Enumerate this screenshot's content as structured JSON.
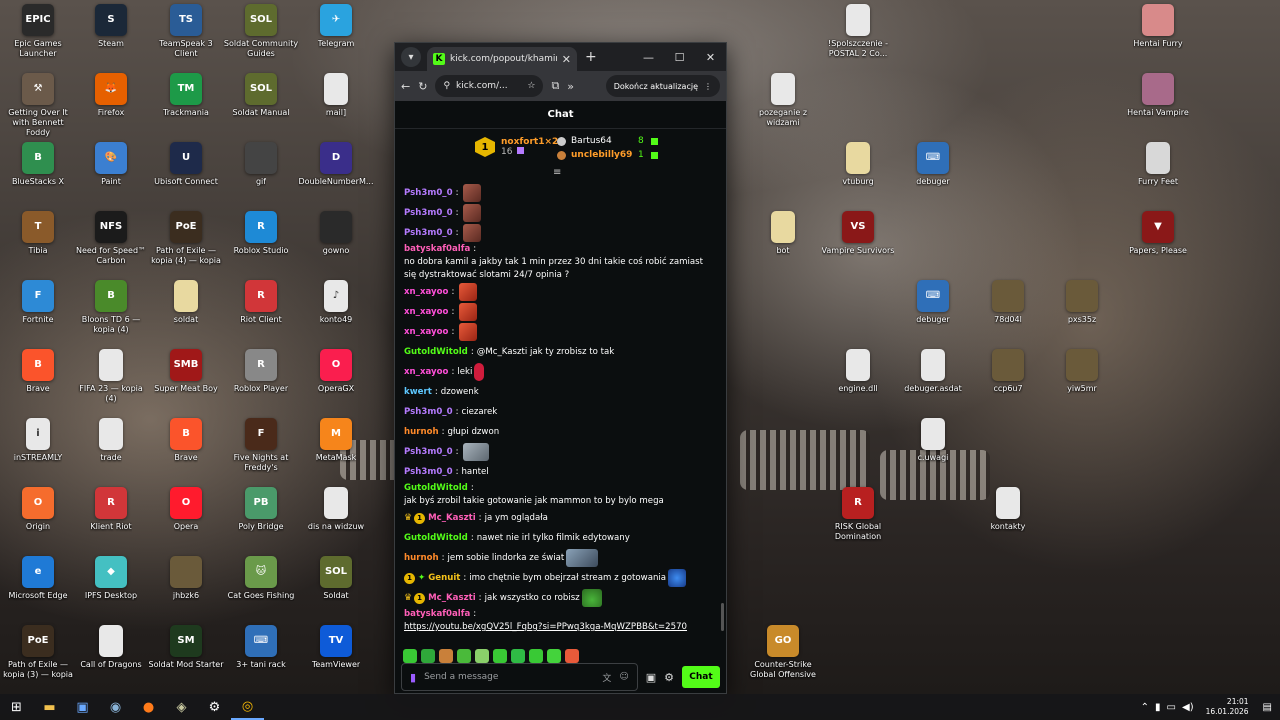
{
  "desktop_icons": [
    {
      "label": "Epic Games Launcher",
      "color": "#2a2a2a",
      "glyph": "EPIC"
    },
    {
      "label": "Steam",
      "color": "#1b2838",
      "glyph": "S"
    },
    {
      "label": "TeamSpeak 3 Client",
      "color": "#2a5c96",
      "glyph": "TS"
    },
    {
      "label": "Soldat Community Guides",
      "color": "#5e6b2e",
      "glyph": "SOL"
    },
    {
      "label": "Telegram",
      "color": "#2aa3df",
      "glyph": "✈"
    },
    {
      "label": "Getting Over It with Bennett Foddy",
      "color": "#6b5a4a",
      "glyph": "⚒"
    },
    {
      "label": "Firefox",
      "color": "#e66000",
      "glyph": "🦊"
    },
    {
      "label": "Trackmania",
      "color": "#1d9a48",
      "glyph": "TM"
    },
    {
      "label": "Soldat Manual",
      "color": "#5e6b2e",
      "glyph": "SOL"
    },
    {
      "label": "mail]",
      "color": "#e8e8e8",
      "glyph": ""
    },
    {
      "label": "BlueStacks X",
      "color": "#2f8f4f",
      "glyph": "B"
    },
    {
      "label": "Paint",
      "color": "#3b7fd1",
      "glyph": "🎨"
    },
    {
      "label": "Ubisoft Connect",
      "color": "#1e2a4a",
      "glyph": "U"
    },
    {
      "label": "gif",
      "color": "#444",
      "glyph": ""
    },
    {
      "label": "DoubleNumberM...",
      "color": "#3a2e8a",
      "glyph": "D"
    },
    {
      "label": "Tibia",
      "color": "#8a5a2a",
      "glyph": "T"
    },
    {
      "label": "Need for Speed™ Carbon",
      "color": "#1b1b1b",
      "glyph": "NFS"
    },
    {
      "label": "Path of Exile — kopia (4) — kopia",
      "color": "#3b2d1f",
      "glyph": "PoE"
    },
    {
      "label": "Roblox Studio",
      "color": "#1e8ad6",
      "glyph": "R"
    },
    {
      "label": "gowno",
      "color": "#2a2a2a",
      "glyph": ""
    },
    {
      "label": "Fortnite",
      "color": "#2d8ad6",
      "glyph": "F"
    },
    {
      "label": "Bloons TD 6 — kopia (4)",
      "color": "#4a8a2a",
      "glyph": "B"
    },
    {
      "label": "soldat",
      "color": "#e8d9a0",
      "glyph": ""
    },
    {
      "label": "Riot Client",
      "color": "#d13639",
      "glyph": "R"
    },
    {
      "label": "konto49",
      "color": "#e8e8e8",
      "glyph": "♪"
    },
    {
      "label": "Brave",
      "color": "#fb542b",
      "glyph": "B"
    },
    {
      "label": "FIFA 23 — kopia (4)",
      "color": "#e8e8e8",
      "glyph": ""
    },
    {
      "label": "Super Meat Boy",
      "color": "#a01818",
      "glyph": "SMB"
    },
    {
      "label": "Roblox Player",
      "color": "#888",
      "glyph": "R"
    },
    {
      "label": "OperaGX",
      "color": "#fa1e4e",
      "glyph": "O"
    },
    {
      "label": "inSTREAMLY",
      "color": "#e8e8e8",
      "glyph": "i"
    },
    {
      "label": "trade",
      "color": "#e8e8e8",
      "glyph": ""
    },
    {
      "label": "Brave",
      "color": "#fb542b",
      "glyph": "B"
    },
    {
      "label": "Five Nights at Freddy's",
      "color": "#4a2a1a",
      "glyph": "F"
    },
    {
      "label": "MetaMask",
      "color": "#f6851b",
      "glyph": "M"
    },
    {
      "label": "Origin",
      "color": "#f56c2d",
      "glyph": "O"
    },
    {
      "label": "Klient Riot",
      "color": "#d13639",
      "glyph": "R"
    },
    {
      "label": "Opera",
      "color": "#ff1b2d",
      "glyph": "O"
    },
    {
      "label": "Poly Bridge",
      "color": "#4a9a6a",
      "glyph": "PB"
    },
    {
      "label": "dis na widzuw",
      "color": "#e8e8e8",
      "glyph": ""
    },
    {
      "label": "Microsoft Edge",
      "color": "#1f7ad6",
      "glyph": "e"
    },
    {
      "label": "IPFS Desktop",
      "color": "#44c0c2",
      "glyph": "◆"
    },
    {
      "label": "jhbzk6",
      "color": "#6a5a3a",
      "glyph": ""
    },
    {
      "label": "Cat Goes Fishing",
      "color": "#6a9a4a",
      "glyph": "🐱"
    },
    {
      "label": "Soldat",
      "color": "#5e6b2e",
      "glyph": "SOL"
    },
    {
      "label": "Path of Exile — kopia (3) — kopia",
      "color": "#3b2d1f",
      "glyph": "PoE"
    },
    {
      "label": "Call of Dragons",
      "color": "#e8e8e8",
      "glyph": ""
    },
    {
      "label": "Soldat Mod Starter",
      "color": "#1e3a1e",
      "glyph": "SM"
    },
    {
      "label": "3+ tani rack",
      "color": "#2f6fb8",
      "glyph": "⌨"
    },
    {
      "label": "TeamViewer",
      "color": "#0e5bd8",
      "glyph": "TV"
    },
    {
      "label": "!Spolszczenie - POSTAL 2 Co...",
      "color": "#e8e8e8",
      "glyph": ""
    },
    {
      "label": "Hentai Furry",
      "color": "#d88a8a",
      "glyph": ""
    },
    {
      "label": "pozeganie z widzami",
      "color": "#e8e8e8",
      "glyph": ""
    },
    {
      "label": "Hentai Vampire",
      "color": "#a86a8a",
      "glyph": ""
    },
    {
      "label": "vtuburg",
      "color": "#e8d9a0",
      "glyph": ""
    },
    {
      "label": "debuger",
      "color": "#2f6fb8",
      "glyph": "⌨"
    },
    {
      "label": "Furry Feet",
      "color": "#d8d8d8",
      "glyph": ""
    },
    {
      "label": "bot",
      "color": "#e8d9a0",
      "glyph": ""
    },
    {
      "label": "Vampire Survivors",
      "color": "#8a1818",
      "glyph": "VS"
    },
    {
      "label": "Papers, Please",
      "color": "#8a1818",
      "glyph": "▼"
    },
    {
      "label": "debuger",
      "color": "#2f6fb8",
      "glyph": "⌨"
    },
    {
      "label": "78d04l",
      "color": "#6a5a3a",
      "glyph": ""
    },
    {
      "label": "pxs35z",
      "color": "#6a5a3a",
      "glyph": ""
    },
    {
      "label": "engine.dll",
      "color": "#e8e8e8",
      "glyph": ""
    },
    {
      "label": "debuger.asdat",
      "color": "#e8e8e8",
      "glyph": ""
    },
    {
      "label": "ccp6u7",
      "color": "#6a5a3a",
      "glyph": ""
    },
    {
      "label": "yiw5mr",
      "color": "#6a5a3a",
      "glyph": ""
    },
    {
      "label": "c.uwagi",
      "color": "#e8e8e8",
      "glyph": ""
    },
    {
      "label": "RISK Global Domination",
      "color": "#b82020",
      "glyph": "R"
    },
    {
      "label": "kontakty",
      "color": "#e8e8e8",
      "glyph": ""
    },
    {
      "label": "Counter-Strike Global Offensive",
      "color": "#c88a2a",
      "glyph": "GO"
    }
  ],
  "browser": {
    "tab_title": "kick.com/popout/khamires/cha",
    "url": "kick.com/...",
    "update_button": "Dokończ aktualizację",
    "window_controls": {
      "minimize": "—",
      "maximize": "☐",
      "close": "✕"
    }
  },
  "chat": {
    "header": "Chat",
    "leaderboard": {
      "top_user": "noxfort1×2",
      "top_rank": "1",
      "top_count": "16",
      "users": [
        {
          "name": "Bartus64",
          "count": "8"
        },
        {
          "name": "unclebilly69",
          "count": "1"
        }
      ]
    },
    "messages": [
      {
        "user": "Psh3m0_0",
        "color": "#b57bff",
        "text": "",
        "emote": "em-face"
      },
      {
        "user": "Psh3m0_0",
        "color": "#b57bff",
        "text": "",
        "emote": "em-face"
      },
      {
        "user": "Psh3m0_0",
        "color": "#b57bff",
        "text": "",
        "emote": "em-face"
      },
      {
        "user": "batyskaf0alfa",
        "color": "#ff5fb8",
        "text": "no dobra kamil a jakby tak 1 min przez 30 dni takie coś robić zamiast się dystraktować slotami 24/7 opinia ?",
        "emote": ""
      },
      {
        "user": "xn_xayoo",
        "color": "#ff4fd8",
        "text": "",
        "emote": "em-red"
      },
      {
        "user": "xn_xayoo",
        "color": "#ff4fd8",
        "text": "",
        "emote": "em-red"
      },
      {
        "user": "xn_xayoo",
        "color": "#ff4fd8",
        "text": "",
        "emote": "em-red"
      },
      {
        "user": "GutoldWitold",
        "color": "#53fc18",
        "text": "@Mc_Kaszti jak ty zrobisz to tak",
        "emote": ""
      },
      {
        "user": "xn_xayoo",
        "color": "#ff4fd8",
        "text": "leki",
        "emote": "em-pill"
      },
      {
        "user": "kwert",
        "color": "#5ec8ff",
        "text": "dzowenk",
        "emote": ""
      },
      {
        "user": "Psh3m0_0",
        "color": "#b57bff",
        "text": "ciezarek",
        "emote": ""
      },
      {
        "user": "hurnoh",
        "color": "#ff8a2a",
        "text": "głupi dzwon",
        "emote": ""
      },
      {
        "user": "Psh3m0_0",
        "color": "#b57bff",
        "text": "",
        "emote": "em-gray"
      },
      {
        "user": "Psh3m0_0",
        "color": "#b57bff",
        "text": "hantel",
        "emote": ""
      },
      {
        "user": "GutoldWitold",
        "color": "#53fc18",
        "text": "jak byś zrobil takie gotowanie jak mammon to by bylo mega",
        "emote": ""
      },
      {
        "user": "Mc_Kaszti",
        "color": "#ff5fb8",
        "badges": "crown-sub",
        "text": "ja ym oglądała",
        "emote": ""
      },
      {
        "user": "GutoldWitold",
        "color": "#53fc18",
        "text": "nawet nie irl tylko filmik edytowany",
        "emote": ""
      },
      {
        "user": "hurnoh",
        "color": "#ff8a2a",
        "text": "jem sobie lindorka ze świat",
        "emote": "em-sky"
      },
      {
        "user": "Genuit",
        "color": "#f4c21a",
        "badges": "sub-vip",
        "text": "imo chętnie bym obejrzał stream z gotowania",
        "emote": "em-blue"
      },
      {
        "user": "Mc_Kaszti",
        "color": "#ff5fb8",
        "badges": "crown-sub",
        "text": "jak wszystko co robisz",
        "emote": "em-frog"
      },
      {
        "user": "batyskaf0alfa",
        "color": "#ff5fb8",
        "text": "",
        "link": "https://youtu.be/xgQV25l_Fqbg?si=PPwq3kga-MqWZPBB&t=2570",
        "emote": ""
      }
    ],
    "input_placeholder": "Send a message",
    "send_label": "Chat"
  },
  "taskbar": {
    "time": "21:01",
    "date": "16.01.2026"
  }
}
